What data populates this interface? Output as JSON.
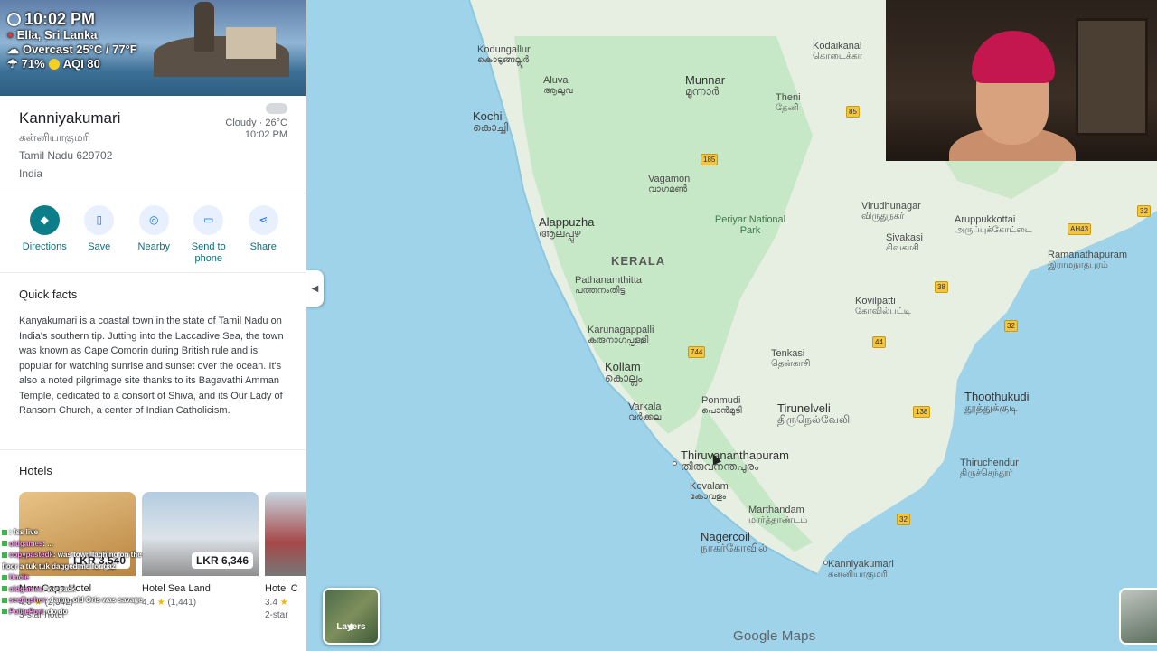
{
  "overlay": {
    "time": "10:02 PM",
    "location": "Ella, Sri Lanka",
    "weather": "Overcast 25°C / 77°F",
    "humidity": "71%",
    "aqi": "AQI 80"
  },
  "place": {
    "name": "Kanniyakumari",
    "name_tamil": "கன்னியாகுமரி",
    "address": "Tamil Nadu 629702",
    "country": "India",
    "weather_text": "Cloudy · 26°C",
    "weather_time": "10:02 PM"
  },
  "actions": [
    {
      "label": "Directions",
      "icon": "directions-icon"
    },
    {
      "label": "Save",
      "icon": "bookmark-icon"
    },
    {
      "label": "Nearby",
      "icon": "nearby-icon"
    },
    {
      "label": "Send to phone",
      "icon": "send-to-phone-icon"
    },
    {
      "label": "Share",
      "icon": "share-icon"
    }
  ],
  "quick_facts": {
    "title": "Quick facts",
    "text": "Kanyakumari is a coastal town in the state of Tamil Nadu on India's southern tip. Jutting into the Laccadive Sea, the town was known as Cape Comorin during British rule and is popular for watching sunrise and sunset over the ocean. It's also a noted pilgrimage site thanks to its Bagavathi Amman Temple, dedicated to a consort of Shiva, and its Our Lady of Ransom Church, a center of Indian Catholicism."
  },
  "hotels": {
    "title": "Hotels",
    "items": [
      {
        "name": "New Cape Hotel",
        "price": "LKR 3,540",
        "rating": "4.0",
        "reviews": "(2,342)",
        "class": "3-star hotel",
        "color": "#c99a4a"
      },
      {
        "name": "Hotel Sea Land",
        "price": "LKR 6,346",
        "rating": "4.4",
        "reviews": "(1,441)",
        "class": "",
        "color": "#a9b5bf"
      },
      {
        "name": "Hotel C",
        "price": "",
        "rating": "3.4",
        "reviews": "",
        "class": "2-star",
        "color": "#8c3a3a"
      }
    ]
  },
  "map": {
    "labels": [
      {
        "name": "Kodungallur",
        "sub": "കൊടുങ്ങല്ലൂർ"
      },
      {
        "name": "Aluva",
        "sub": "ആലുവ"
      },
      {
        "name": "Kochi",
        "sub": "കൊച്ചി"
      },
      {
        "name": "Munnar",
        "sub": "മൂന്നാർ"
      },
      {
        "name": "Kodaikanal",
        "sub": "கொடைக்கா"
      },
      {
        "name": "Theni",
        "sub": "தேனி"
      },
      {
        "name": "Vagamon",
        "sub": "വാഗമൺ"
      },
      {
        "name": "Alappuzha",
        "sub": "ആലപ്പുഴ"
      },
      {
        "name": "Periyar National Park",
        "sub": "പെരിയാർ ദേശീയോദ്യാനം"
      },
      {
        "name": "KERALA",
        "sub": ""
      },
      {
        "name": "Pathanamthitta",
        "sub": "പത്തനംതിട്ട"
      },
      {
        "name": "Virudhunagar",
        "sub": "விருதுநகர்"
      },
      {
        "name": "Aruppukkottai",
        "sub": "அருப்புக்கோட்டை"
      },
      {
        "name": "Sivakasi",
        "sub": "சிவகாசி"
      },
      {
        "name": "Ramanathapuram",
        "sub": "இராமநாதபுரம்"
      },
      {
        "name": "Kovilpatti",
        "sub": "கோவில்பட்டி"
      },
      {
        "name": "Karunagappalli",
        "sub": "കരുനാഗപ്പള്ളി"
      },
      {
        "name": "Tenkasi",
        "sub": "தென்காசி"
      },
      {
        "name": "Kollam",
        "sub": "കൊല്ലം"
      },
      {
        "name": "Thoothukudi",
        "sub": "தூத்துக்குடி"
      },
      {
        "name": "Varkala",
        "sub": "വർക്കല"
      },
      {
        "name": "Ponmudi",
        "sub": "പൊൻമുടി"
      },
      {
        "name": "Tirunelveli",
        "sub": "திருநெல்வேலி"
      },
      {
        "name": "Thiruvananthapuram",
        "sub": "തിരുവനന്തപുരം"
      },
      {
        "name": "Thiruchendur",
        "sub": "திருச்செந்தூர்"
      },
      {
        "name": "Kovalam",
        "sub": "കോവളം"
      },
      {
        "name": "Marthandam",
        "sub": "மார்த்தாண்டம்"
      },
      {
        "name": "Nagercoil",
        "sub": "நாகர்கோவில்"
      },
      {
        "name": "Kanniyakumari",
        "sub": "கன்னியாகுமரி"
      }
    ],
    "shields": [
      "85",
      "185",
      "744",
      "44",
      "38",
      "32",
      "138",
      "32",
      "32",
      "AH43"
    ],
    "layers_label": "Layers",
    "brand": "Google Maps"
  },
  "chat": [
    {
      "user": "",
      "text": ": fss live"
    },
    {
      "user": "oldgames",
      "text": ": ..."
    },
    {
      "user": "copypastedk",
      "text": ": was town laghing on the"
    },
    {
      "user": "",
      "text": "floor a tuk tuk dagged me for gaz"
    },
    {
      "user": "Uncle",
      "text": ""
    },
    {
      "user": "oldgames",
      "text": ": we pack"
    },
    {
      "user": "seeflusher",
      "text": ": damn, old Oris was savage"
    },
    {
      "user": "PolitePort",
      "text": ": do do"
    }
  ]
}
